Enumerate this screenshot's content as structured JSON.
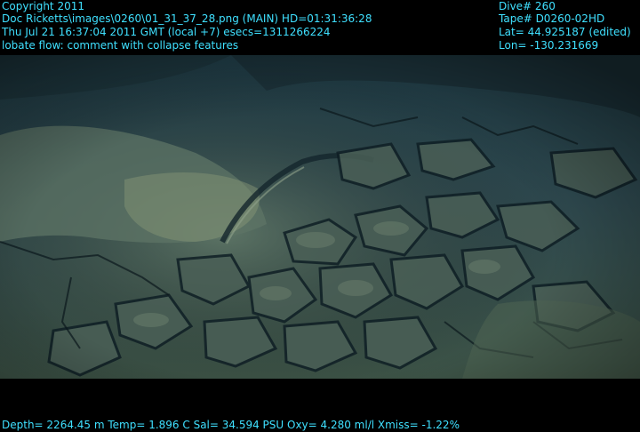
{
  "overlay": {
    "copyright": "Copyright 2011",
    "image_path": "Doc Ricketts\\images\\0260\\01_31_37_28.png (MAIN)  HD=01:31:36:28",
    "datetime": "Thu Jul 21 16:37:04 2011 GMT (local +7)  esecs=1311266224",
    "description": "lobate flow: comment with collapse features",
    "dive": "Dive# 260",
    "tape": "Tape# D0260-02HD",
    "lat": "Lat= 44.925187 (edited)",
    "lon": "Lon= -130.231669",
    "sensors": "Depth= 2264.45 m  Temp= 1.896 C  Sal= 34.594 PSU  Oxy= 4.280 ml/l  Xmiss= -1.22%"
  },
  "colors": {
    "overlay_text": "#3fe0ff",
    "seafloor_dark": "#1c3038",
    "seafloor_light": "#6a8270"
  }
}
